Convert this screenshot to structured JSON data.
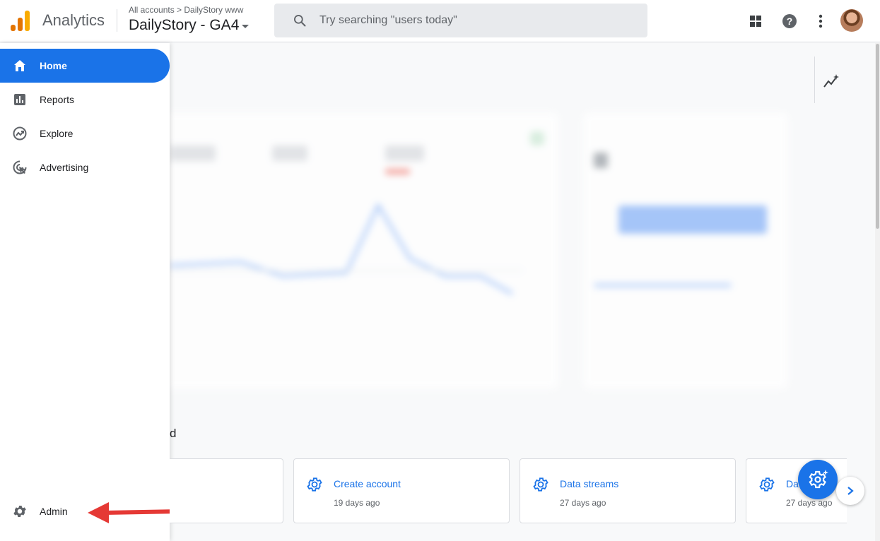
{
  "app": {
    "name": "Analytics",
    "breadcrumb": "All accounts > DailyStory www",
    "property_name": "DailyStory - GA4",
    "logo_colors": [
      "#f9ab00",
      "#e37400",
      "#e37400"
    ]
  },
  "search": {
    "placeholder": "Try searching \"users today\""
  },
  "topbar_icons": [
    "apps-icon",
    "help-icon",
    "more-vert-icon",
    "avatar"
  ],
  "sidebar": {
    "items": [
      {
        "label": "Home",
        "icon": "home-icon",
        "active": true
      },
      {
        "label": "Reports",
        "icon": "bar-chart-icon"
      },
      {
        "label": "Explore",
        "icon": "explore-icon"
      },
      {
        "label": "Advertising",
        "icon": "advertising-icon"
      }
    ],
    "admin": {
      "label": "Admin",
      "icon": "gear-icon"
    }
  },
  "main": {
    "section_title_fragment": "d",
    "recent_cards": [
      {
        "title": "",
        "time": ""
      },
      {
        "title": "Create account",
        "time": "19 days ago"
      },
      {
        "title": "Data streams",
        "time": "27 days ago"
      },
      {
        "title": "Da",
        "time": "27 days ago"
      }
    ]
  },
  "colors": {
    "accent": "#1a73e8",
    "annotation": "#e53935"
  }
}
